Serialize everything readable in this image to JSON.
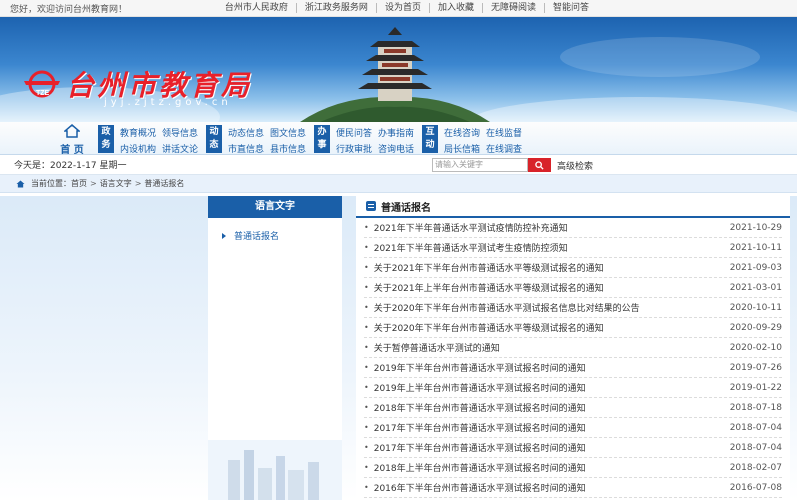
{
  "topbar": {
    "welcome": "您好，欢迎访问台州教育网！",
    "links": [
      "台州市人民政府",
      "浙江政务服务网",
      "设为首页",
      "加入收藏",
      "无障碍阅读",
      "智能问答"
    ]
  },
  "banner": {
    "title": "台州市教育局",
    "domain": "jyj.zjtz.gov.cn",
    "logo_text": "TZE"
  },
  "nav": {
    "home": "首 页",
    "groups": [
      {
        "tag": "政务",
        "links": [
          "教育概况",
          "领导信息",
          "内设机构",
          "讲话文论"
        ]
      },
      {
        "tag": "动态",
        "links": [
          "动态信息",
          "图文信息",
          "市直信息",
          "县市信息"
        ]
      },
      {
        "tag": "办事",
        "links": [
          "便民问答",
          "办事指南",
          "行政审批",
          "咨询电话"
        ]
      },
      {
        "tag": "互动",
        "links": [
          "在线咨询",
          "在线监督",
          "局长信箱",
          "在线调查"
        ]
      }
    ]
  },
  "infobar": {
    "date": "今天是：2022-1-17 星期一",
    "search_placeholder": "请输入关键字",
    "advanced": "高级检索"
  },
  "breadcrumb": {
    "label": "当前位置：",
    "items": [
      "首页",
      "语言文字",
      "普通话报名"
    ]
  },
  "sidebar": {
    "title": "语言文字",
    "items": [
      "普通话报名"
    ]
  },
  "content": {
    "title": "普通话报名",
    "rows": [
      {
        "title": "2021年下半年普通话水平测试疫情防控补充通知",
        "date": "2021-10-29"
      },
      {
        "title": "2021年下半年普通话水平测试考生疫情防控须知",
        "date": "2021-10-11"
      },
      {
        "title": "关于2021年下半年台州市普通话水平等级测试报名的通知",
        "date": "2021-09-03"
      },
      {
        "title": "关于2021年上半年台州市普通话水平等级测试报名的通知",
        "date": "2021-03-01"
      },
      {
        "title": "关于2020年下半年台州市普通话水平测试报名信息比对结果的公告",
        "date": "2020-10-11"
      },
      {
        "title": "关于2020年下半年台州市普通话水平等级测试报名的通知",
        "date": "2020-09-29"
      },
      {
        "title": "关于暂停普通话水平测试的通知",
        "date": "2020-02-10"
      },
      {
        "title": "2019年下半年台州市普通话水平测试报名时间的通知",
        "date": "2019-07-26"
      },
      {
        "title": "2019年上半年台州市普通话水平测试报名时间的通知",
        "date": "2019-01-22"
      },
      {
        "title": "2018年下半年台州市普通话水平测试报名时间的通知",
        "date": "2018-07-18"
      },
      {
        "title": "2017年下半年台州市普通话水平测试报名时间的通知",
        "date": "2018-07-04"
      },
      {
        "title": "2017年下半年台州市普通话水平测试报名时间的通知",
        "date": "2018-07-04"
      },
      {
        "title": "2018年上半年台州市普通话水平测试报名时间的通知",
        "date": "2018-02-07"
      },
      {
        "title": "2016年下半年台州市普通话水平测试报名时间的通知",
        "date": "2016-07-08"
      }
    ]
  },
  "colors": {
    "primary": "#1a5fa8",
    "accent": "#d8232a",
    "logo": "#e8202a"
  }
}
